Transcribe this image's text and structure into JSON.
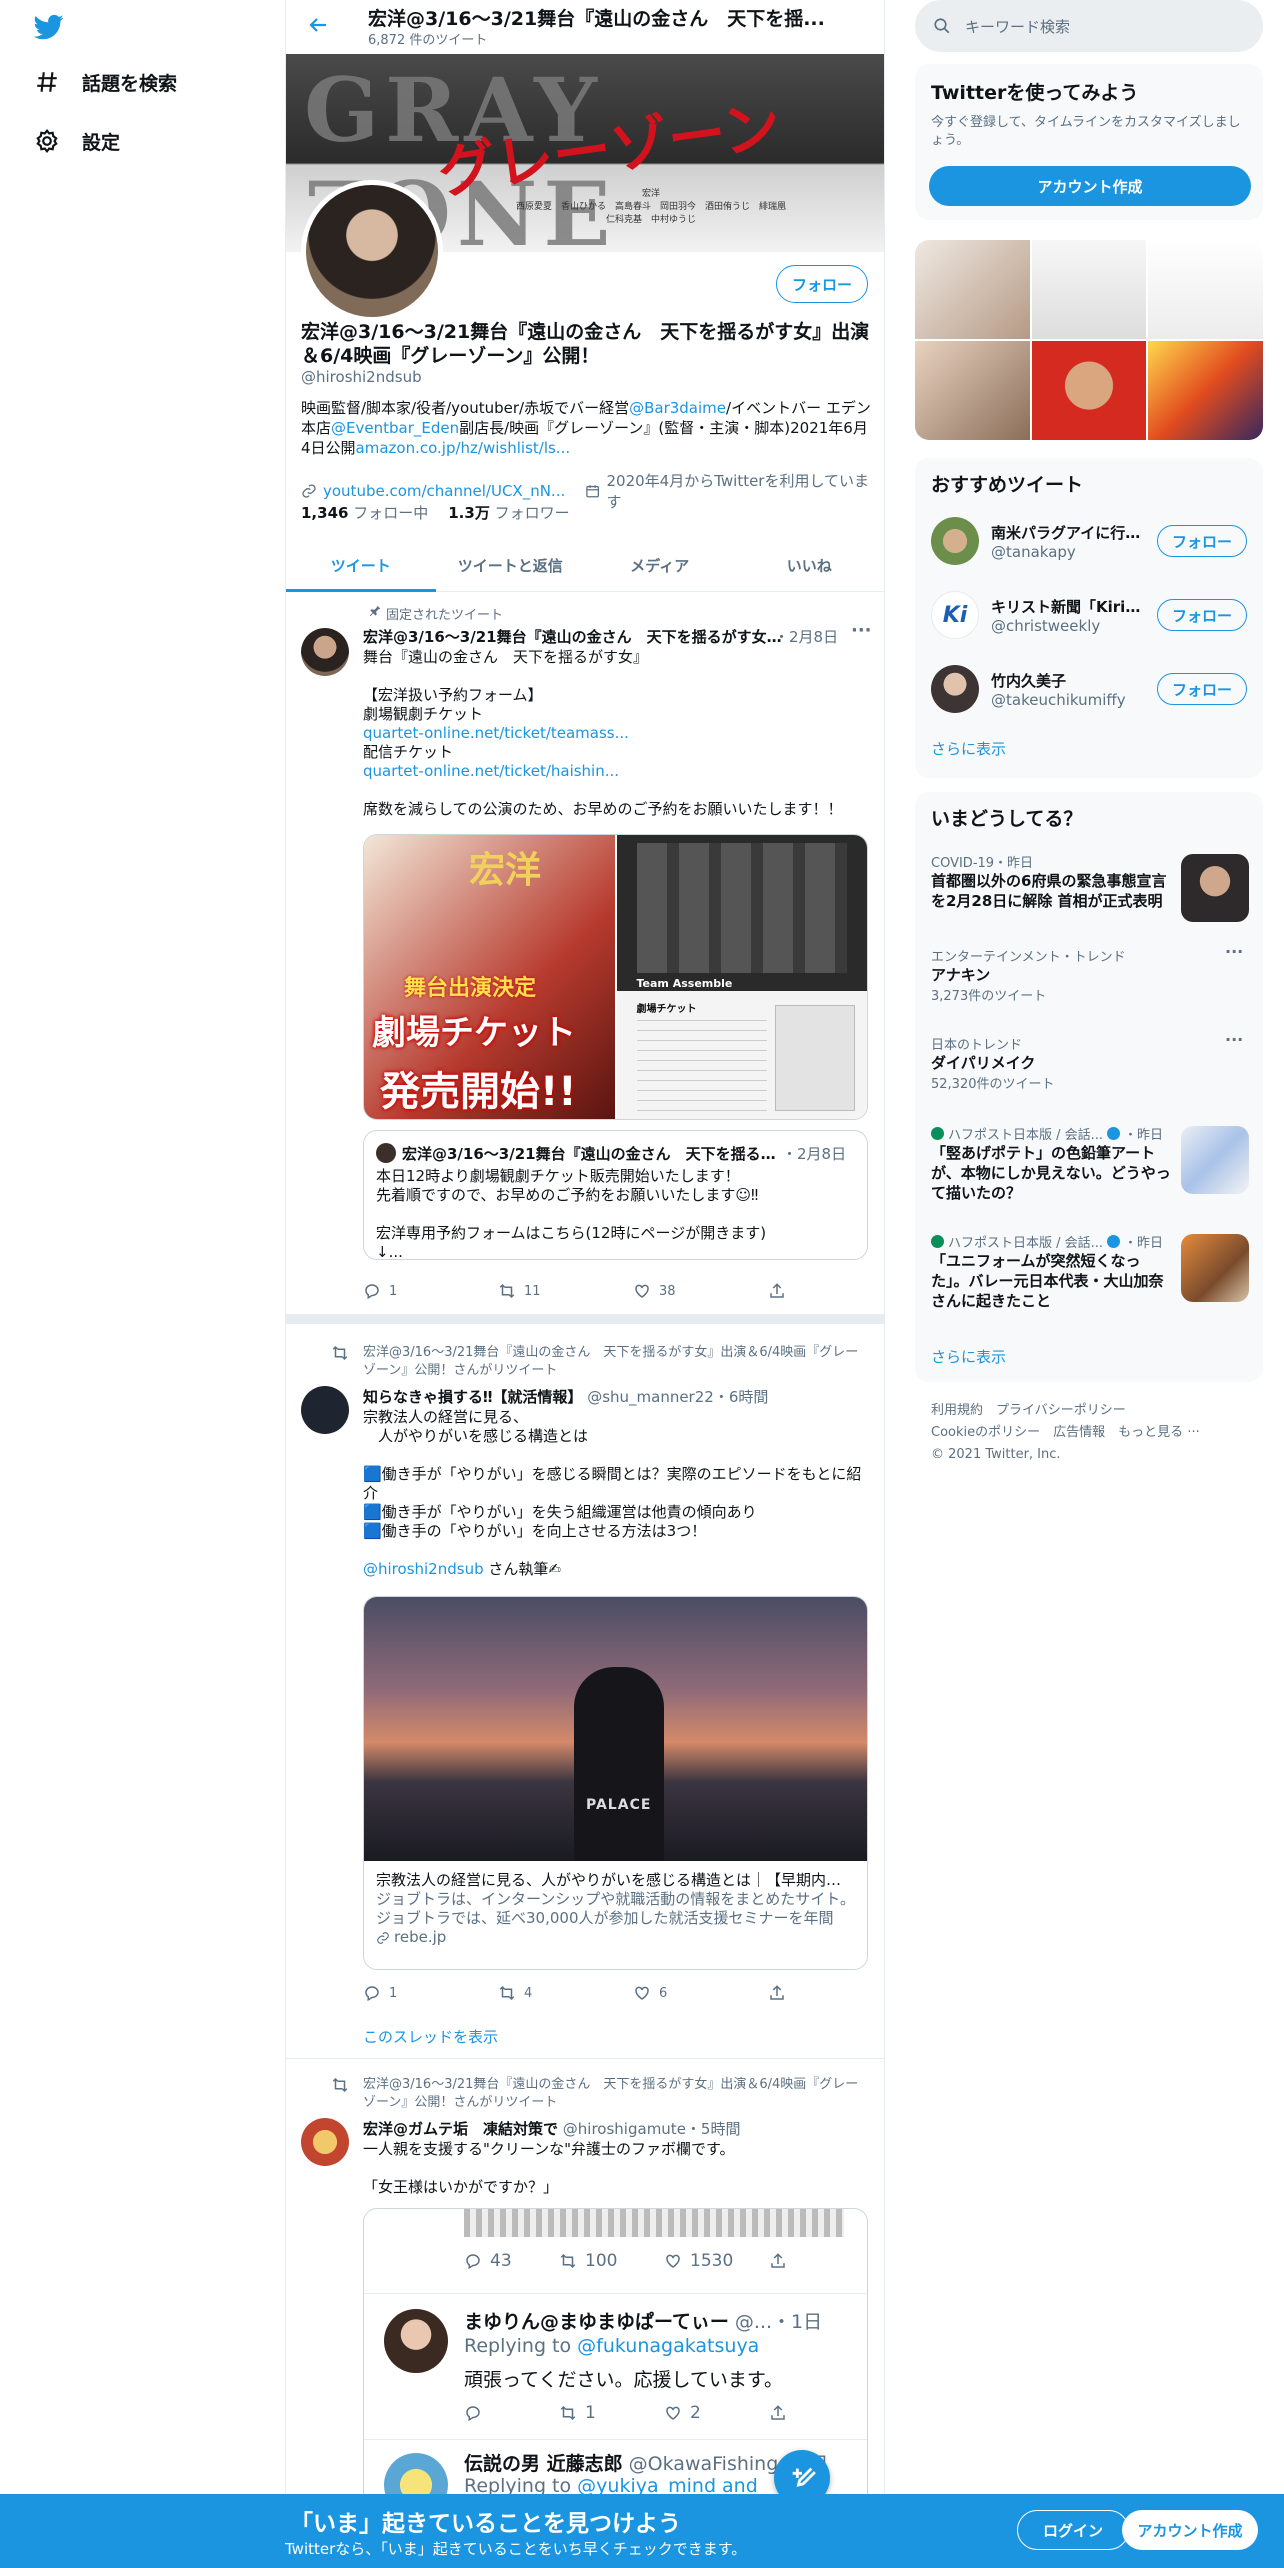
{
  "nav": {
    "explore": "話題を検索",
    "settings": "設定"
  },
  "header": {
    "title": "宏洋@3/16〜3/21舞台『遠山の金さん　天下を揺...",
    "tweet_count": "6,872 件のツイート"
  },
  "banner": {
    "title_en": "GRAY ZONE",
    "title_jp": "グレーゾーン",
    "credits": "宏洋\n西原愛夏　香山ひかる　高島春斗　岡田羽今　酒田侑うじ　緋瑞凰\n仁科克基　中村ゆうじ"
  },
  "profile": {
    "name": "宏洋@3/16〜3/21舞台『遠山の金さん　天下を揺るがす女』出演＆6/4映画『グレーゾーン』公開！",
    "handle": "@hiroshi2ndsub",
    "follow_label": "フォロー",
    "bio_1": "映画監督/脚本家/役者/youtuber/赤坂でバー経営",
    "bio_mention1": "@Bar3daime",
    "bio_2": "/イベントバー エデン本店",
    "bio_mention2": "@Eventbar_Eden",
    "bio_3": "副店長/映画『グレーゾーン』(監督・主演・脚本)2021年6月4日公開",
    "bio_link": "amazon.co.jp/hz/wishlist/ls...",
    "url": "youtube.com/channel/UCX_nN...",
    "joined": "2020年4月からTwitterを利用しています",
    "following_count": "1,346",
    "following_label": "フォロー中",
    "followers_count": "1.3万",
    "followers_label": "フォロワー"
  },
  "tabs": [
    "ツイート",
    "ツイートと返信",
    "メディア",
    "いいね"
  ],
  "tweet1": {
    "pinned": "固定されたツイート",
    "name": "宏洋@3/16〜3/21舞台『遠山の金さん　天下を揺るがす女...",
    "date": "・2月8日",
    "text_1": "舞台『遠山の金さん　天下を揺るがす女』\n\n【宏洋扱い予約フォーム】\n劇場観劇チケット",
    "link_1": "quartet-online.net/ticket/teamass...",
    "text_2": "配信チケット",
    "link_2": "quartet-online.net/ticket/haishin...",
    "text_3": "席数を減らしての公演のため、お早めのご予約をお願いいたします！！",
    "img_left": {
      "t1": "宏洋",
      "t2": "舞台出演決定",
      "t3": "劇場チケット",
      "t4": "発売開始!!"
    },
    "img_right": {
      "t1": "Team Assemble",
      "t2": "劇場チケット"
    },
    "quote": {
      "name": "宏洋@3/16〜3/21舞台『遠山の金さん　天下を揺るがす女...",
      "date": "・2月8日",
      "text": "本日12時より劇場観劇チケット販売開始いたします！\n先着順ですので、お早めのご予約をお願いいたします☺‼\n\n宏洋専用予約フォームはこちら(12時にページが開きます)\n↓..."
    },
    "replies": "1",
    "retweets": "11",
    "likes": "38"
  },
  "tweet2": {
    "retweet_by": "宏洋@3/16〜3/21舞台『遠山の金さん　天下を揺るがす女』出演＆6/4映画『グレーゾーン』公開！さんがリツイート",
    "name": "知らなきゃ損する‼【就活情報】",
    "handle": "@shu_manner22",
    "time": "・6時間",
    "text": "宗教法人の経営に見る、\n　人がやりがいを感じる構造とは\n\n🟦働き手が「やりがい」を感じる瞬間とは？実際のエピソードをもとに紹介\n🟦働き手が「やりがい」を失う組織運営は他責の傾向あり\n🟦働き手の「やりがい」を向上させる方法は3つ！",
    "mention": "@hiroshi2ndsub",
    "mention_suffix": " さん執筆✍",
    "card_logo": "PALACE",
    "card_title": "宗教法人の経営に見る、人がやりがいを感じる構造とは｜【早期内定...",
    "card_desc": "ジョブトラは、インターンシップや就職活動の情報をまとめたサイト。ジョブトラでは、延べ30,000人が参加した就活支援セミナーを年間約...",
    "card_domain": "rebe.jp",
    "replies": "1",
    "retweets": "4",
    "likes": "6",
    "show_thread": "このスレッドを表示"
  },
  "tweet3": {
    "retweet_by": "宏洋@3/16〜3/21舞台『遠山の金さん　天下を揺るがす女』出演＆6/4映画『グレーゾーン』公開！さんがリツイート",
    "name": "宏洋@ガムテ垢　凍結対策で",
    "handle": "@hiroshigamute",
    "time": "・5時間",
    "text": "一人親を支援する\"クリーンな\"弁護士のファボ欄です。\n\n「女王様はいかがですか？」",
    "inner_counts": {
      "replies": "43",
      "retweets": "100",
      "likes": "1530"
    },
    "reply1": {
      "name": "まゆりん@まゆまゆぱーてぃー",
      "handle": "@...",
      "time": "・1日",
      "replying": "Replying to ",
      "replying_handle": "@fukunagakatsuya",
      "text": "頑張ってください。応援しています。",
      "retweets": "1",
      "likes": "2"
    },
    "reply2": {
      "name": "伝説の男 近藤志郎",
      "handle": "@OkawaFishing",
      "time": "・2日",
      "replying": "Replying to ",
      "replying_handle": "@yukiya_mind and"
    }
  },
  "right": {
    "search_placeholder": "キーワード検索",
    "signup": {
      "title": "Twitterを使ってみよう",
      "desc": "今すぐ登録して、タイムラインをカスタマイズしましょう。",
      "button": "アカウント作成"
    },
    "recommended": {
      "title": "おすすめツイート",
      "items": [
        {
          "name": "南米パラグアイに行...",
          "handle": "@tanakapy",
          "follow": "フォロー"
        },
        {
          "name": "キリスト新聞「Kiris...",
          "handle": "@christweekly",
          "follow": "フォロー"
        },
        {
          "name": "竹内久美子",
          "handle": "@takeuchikumiffy",
          "follow": "フォロー"
        }
      ],
      "more": "さらに表示"
    },
    "trends": {
      "title": "いまどうしてる？",
      "items": [
        {
          "cat": "COVID-19・昨日",
          "title": "首都圏以外の6府県の緊急事態宣言を2月28日に解除 首相が正式表明"
        },
        {
          "cat": "エンターテインメント・トレンド",
          "title": "アナキン",
          "count": "3,273件のツイート"
        },
        {
          "cat": "日本のトレンド",
          "title": "ダイパリメイク",
          "count": "52,320件のツイート"
        },
        {
          "cat": "ハフポスト日本版 / 会話...",
          "time": "・昨日",
          "title": "「竪あげポテト」の色鉛筆アートが、本物にしか見えない。どうやって描いたの？"
        },
        {
          "cat": "ハフポスト日本版 / 会話...",
          "time": "・昨日",
          "title": "「ユニフォームが突然短くなった」。バレー元日本代表・大山加奈さんに起きたこと"
        }
      ],
      "more": "さらに表示"
    },
    "footer": {
      "l1": "利用規約",
      "l2": "プライバシーポリシー",
      "l3": "Cookieのポリシー",
      "l4": "広告情報",
      "l5": "もっと見る",
      "copy": "© 2021 Twitter, Inc."
    }
  },
  "bottom": {
    "title": "「いま」起きていることを見つけよう",
    "sub": "Twitterなら、「いま」起きていることをいち早くチェックできます。",
    "login": "ログイン",
    "signup": "アカウント作成"
  },
  "colors": {
    "accent": "#1b95e0",
    "muted": "#5b7083",
    "border": "#e6ecf0"
  }
}
